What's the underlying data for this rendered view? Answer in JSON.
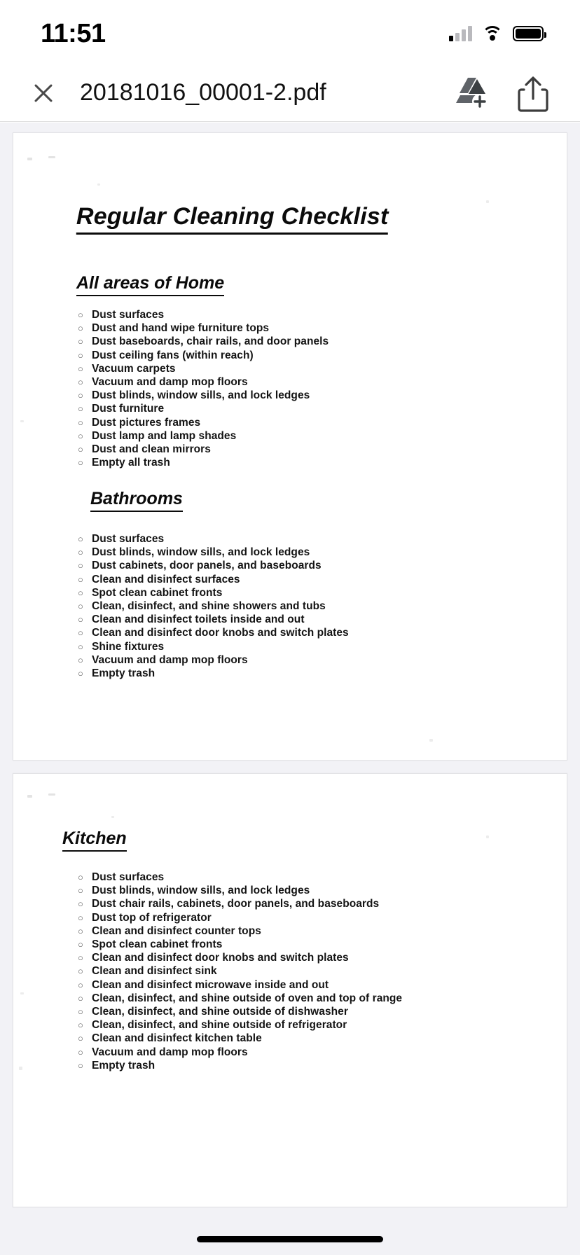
{
  "status_bar": {
    "time": "11:51",
    "signal_icon": "cellular-signal-icon",
    "wifi_icon": "wifi-icon",
    "battery_icon": "battery-full-icon"
  },
  "nav_bar": {
    "close_icon": "close-icon",
    "title": "20181016_00001-2.pdf",
    "save_to_drive_icon": "google-drive-add-icon",
    "share_icon": "share-icon"
  },
  "document": {
    "title": "Regular Cleaning Checklist",
    "sections": [
      {
        "heading": "All areas of Home",
        "bullet": "○",
        "items": [
          "Dust surfaces",
          "Dust and hand wipe furniture tops",
          "Dust baseboards, chair rails, and door panels",
          "Dust ceiling fans (within reach)",
          "Vacuum carpets",
          "Vacuum and damp mop floors",
          "Dust blinds, window sills, and lock ledges",
          "Dust furniture",
          "Dust pictures frames",
          "Dust lamp and lamp shades",
          "Dust and clean mirrors",
          "Empty all trash"
        ]
      },
      {
        "heading": "Bathrooms",
        "bullet": "○",
        "items": [
          "Dust surfaces",
          "Dust blinds, window sills, and lock ledges",
          "Dust cabinets, door panels, and baseboards",
          "Clean and disinfect surfaces",
          "Spot clean cabinet fronts",
          "Clean, disinfect, and shine showers and tubs",
          "Clean and disinfect toilets inside and out",
          "Clean and disinfect door knobs and switch plates",
          "Shine fixtures",
          "Vacuum and damp mop floors",
          "Empty trash"
        ]
      },
      {
        "heading": "Kitchen",
        "bullet": "○",
        "items": [
          "Dust surfaces",
          "Dust blinds, window sills, and lock ledges",
          "Dust chair rails, cabinets, door panels, and baseboards",
          "Dust top of refrigerator",
          "Clean and disinfect counter tops",
          "Spot clean cabinet fronts",
          "Clean and disinfect door knobs and switch plates",
          "Clean and disinfect sink",
          "Clean and disinfect microwave inside and out",
          "Clean, disinfect, and shine outside of oven and top of range",
          "Clean, disinfect, and shine outside of dishwasher",
          "Clean, disinfect, and shine outside of refrigerator",
          "Clean and disinfect kitchen table",
          "Vacuum and damp mop floors",
          "Empty trash"
        ]
      }
    ]
  },
  "home_indicator": "home-indicator"
}
